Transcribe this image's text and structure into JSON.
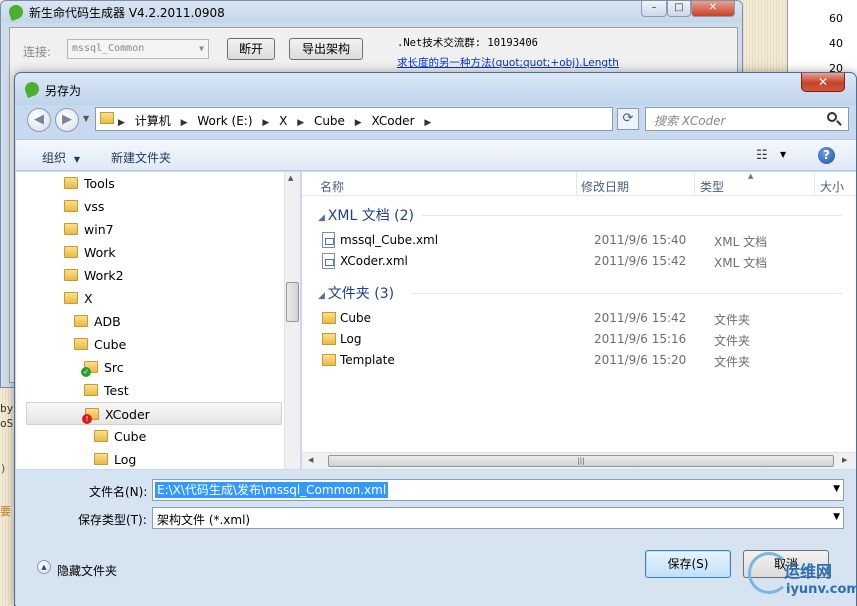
{
  "background": {
    "chart_ticks": [
      "60",
      "40",
      "20"
    ],
    "left_fragments": [
      "by",
      "oS",
      ")",
      "要"
    ]
  },
  "generator": {
    "title": "新生命代码生成器 V4.2.2011.0908",
    "connection_label": "连接:",
    "connection_value": "mssql_Common",
    "disconnect_button": "断开",
    "export_button": "导出架构",
    "net_group_text": ".Net技术交流群: 10193406",
    "link_text": "求长度的另一种方法(quot;quot;+obj).Length"
  },
  "dialog": {
    "title": "另存为",
    "close_label": "✕",
    "breadcrumb": [
      "计算机",
      "Work (E:)",
      "X",
      "Cube",
      "XCoder"
    ],
    "search_placeholder": "搜索 XCoder",
    "toolbar": {
      "organize": "组织",
      "new_folder": "新建文件夹",
      "help": "?"
    },
    "tree": [
      {
        "label": "Tools",
        "indent": 0,
        "icon": "folder"
      },
      {
        "label": "vss",
        "indent": 0,
        "icon": "folder"
      },
      {
        "label": "win7",
        "indent": 0,
        "icon": "folder"
      },
      {
        "label": "Work",
        "indent": 0,
        "icon": "folder"
      },
      {
        "label": "Work2",
        "indent": 0,
        "icon": "folder"
      },
      {
        "label": "X",
        "indent": 0,
        "icon": "folder"
      },
      {
        "label": "ADB",
        "indent": 1,
        "icon": "folder"
      },
      {
        "label": "Cube",
        "indent": 1,
        "icon": "folder"
      },
      {
        "label": "Src",
        "indent": 2,
        "icon": "folder-check"
      },
      {
        "label": "Test",
        "indent": 2,
        "icon": "folder"
      },
      {
        "label": "XCoder",
        "indent": 2,
        "icon": "folder-error",
        "selected": true
      },
      {
        "label": "Cube",
        "indent": 3,
        "icon": "folder"
      },
      {
        "label": "Log",
        "indent": 3,
        "icon": "folder"
      }
    ],
    "columns": {
      "name": "名称",
      "modified": "修改日期",
      "type": "类型",
      "size": "大小"
    },
    "groups": [
      {
        "header": "XML 文档 (2)",
        "files": [
          {
            "name": "mssql_Cube.xml",
            "date": "2011/9/6 15:40",
            "type": "XML 文档",
            "icon": "xml-file-icon"
          },
          {
            "name": "XCoder.xml",
            "date": "2011/9/6 15:42",
            "type": "XML 文档",
            "icon": "xml-file-icon"
          }
        ]
      },
      {
        "header": "文件夹 (3)",
        "files": [
          {
            "name": "Cube",
            "date": "2011/9/6 15:42",
            "type": "文件夹",
            "icon": "folder-icon"
          },
          {
            "name": "Log",
            "date": "2011/9/6 15:16",
            "type": "文件夹",
            "icon": "folder-icon"
          },
          {
            "name": "Template",
            "date": "2011/9/6 15:20",
            "type": "文件夹",
            "icon": "folder-icon"
          }
        ]
      }
    ],
    "filename_label": "文件名(N):",
    "filename_value": "E:\\X\\代码生成\\发布\\mssql_Common.xml",
    "filetype_label": "保存类型(T):",
    "filetype_value": "架构文件 (*.xml)",
    "hide_folders": "隐藏文件夹",
    "save_button": "保存(S)",
    "cancel_button": "取消"
  },
  "watermark": {
    "cn": "运维网",
    "url": "iyunv.com"
  }
}
